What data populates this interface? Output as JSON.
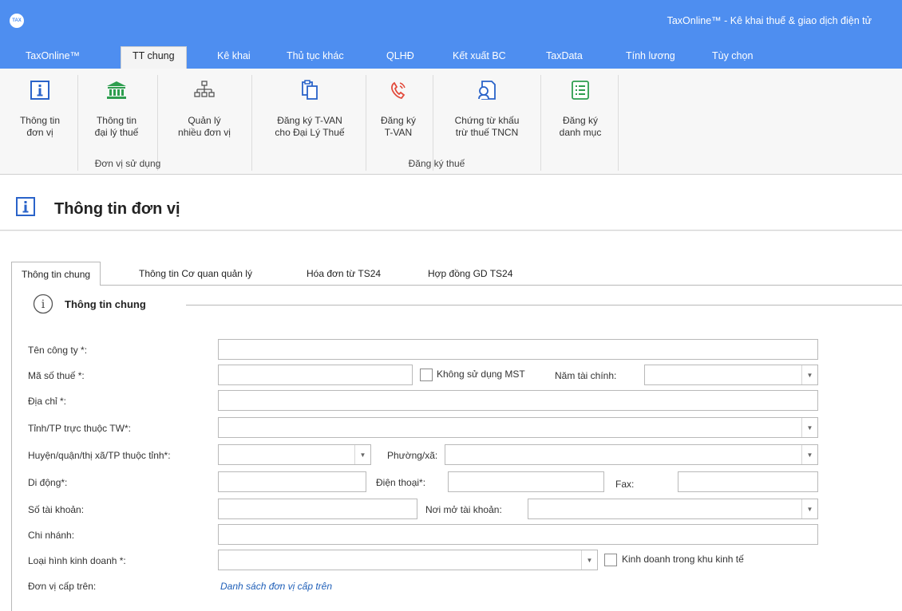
{
  "app": {
    "logo_text": "TAX",
    "window_title": "TaxOnline™ - Kê khai thuế & giao dịch điện tử"
  },
  "menu": {
    "tabs": [
      {
        "label": "TaxOnline™"
      },
      {
        "label": "TT chung",
        "active": true
      },
      {
        "label": "Kê khai"
      },
      {
        "label": "Thủ tục khác"
      },
      {
        "label": "QLHĐ"
      },
      {
        "label": "Kết xuất BC"
      },
      {
        "label": "TaxData"
      },
      {
        "label": "Tính lương"
      },
      {
        "label": "Tùy chọn"
      }
    ]
  },
  "ribbon": {
    "buttons": [
      {
        "label": "Thông tin\nđơn vị",
        "icon": "info-icon"
      },
      {
        "label": "Thông tin\nđại lý thuế",
        "icon": "bank-icon"
      },
      {
        "label": "Quản lý\nnhiều đơn vị",
        "icon": "org-chart-icon"
      },
      {
        "label": "Đăng ký T-VAN\ncho Đại Lý Thuế",
        "icon": "clipboard-icon"
      },
      {
        "label": "Đăng ký\nT-VAN",
        "icon": "phone-icon"
      },
      {
        "label": "Chứng từ khấu\ntrừ thuế TNCN",
        "icon": "document-user-icon"
      },
      {
        "label": "Đăng ký\ndanh mục",
        "icon": "list-icon"
      }
    ],
    "groups": [
      {
        "label": "Đơn vị sử dụng"
      },
      {
        "label": "Đăng ký thuế"
      }
    ],
    "accent_color": "#2a63c9",
    "green_color": "#2e9e4f",
    "red_color": "#e24a3b"
  },
  "page": {
    "title": "Thông tin đơn vị"
  },
  "content_tabs": [
    {
      "label": "Thông tin chung",
      "active": true
    },
    {
      "label": "Thông tin Cơ quan quản lý"
    },
    {
      "label": "Hóa đơn từ TS24"
    },
    {
      "label": "Hợp đồng GD TS24"
    }
  ],
  "section": {
    "title": "Thông tin chung"
  },
  "form": {
    "company_name": {
      "label": "Tên công ty *:",
      "value": ""
    },
    "tax_code": {
      "label": "Mã số thuế *:",
      "value": ""
    },
    "no_tax_code": {
      "label": "Không sử dụng MST",
      "checked": false
    },
    "fiscal_year": {
      "label": "Năm tài chính:",
      "value": ""
    },
    "address": {
      "label": "Địa chỉ *:",
      "value": ""
    },
    "province": {
      "label": "Tỉnh/TP trực thuộc TW*:",
      "value": ""
    },
    "district": {
      "label": "Huyện/quận/thị xã/TP thuộc tỉnh*:",
      "value": ""
    },
    "ward": {
      "label": "Phường/xã:",
      "value": ""
    },
    "mobile": {
      "label": "Di động*:",
      "value": ""
    },
    "phone": {
      "label": "Điện thoại*:",
      "value": ""
    },
    "fax": {
      "label": "Fax:",
      "value": ""
    },
    "account_no": {
      "label": "Số tài khoản:",
      "value": ""
    },
    "bank": {
      "label": "Nơi mở tài khoản:",
      "value": ""
    },
    "branch": {
      "label": "Chi nhánh:",
      "value": ""
    },
    "business_type": {
      "label": "Loại hình kinh doanh *:",
      "value": ""
    },
    "economic_zone": {
      "label": "Kinh doanh trong khu kinh tế",
      "checked": false
    },
    "parent_unit": {
      "label": "Đơn vị cấp trên:",
      "link": "Danh sách đơn vị cấp trên"
    }
  }
}
